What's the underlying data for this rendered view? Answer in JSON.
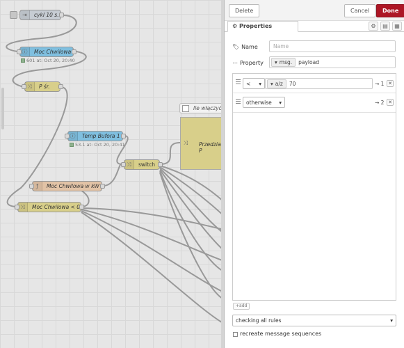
{
  "workspace": {
    "nodes": {
      "cycle": "cykl 10 s. ↻",
      "moc_chwilowa": "Moc Chwilowa",
      "moc_status": "601 at: Oct 20, 20:40",
      "p_sr": "P śr.",
      "temp_bufora": "Temp Bufora 1",
      "temp_status": "53.1 at: Oct 20, 20:41",
      "switch": "switch",
      "moc_kw": "Moc Chwilowa w kW",
      "moc_lt0": "Moc Chwilowa < 0",
      "comment": "Ile włączyć?",
      "przedzialy": "Przedziały P"
    }
  },
  "panel": {
    "delete_label": "Delete",
    "cancel_label": "Cancel",
    "done_label": "Done",
    "tab_properties": "Properties",
    "name_label": "Name",
    "name_placeholder": "Name",
    "property_label": "Property",
    "property_type": "msg.",
    "property_value": "payload",
    "rules": [
      {
        "op": "<",
        "type_icon": "a/z",
        "value": "70",
        "output": "1"
      },
      {
        "op": "otherwise",
        "output": "2"
      }
    ],
    "add_label": "add",
    "mode_value": "checking all rules",
    "recreate_label": "recreate message sequences"
  }
}
